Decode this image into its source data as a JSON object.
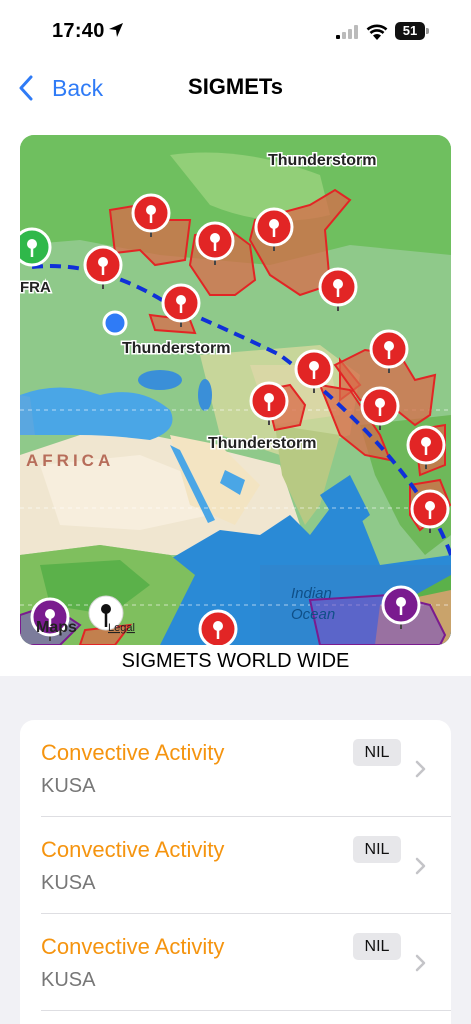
{
  "status_bar": {
    "time": "17:40",
    "battery": "51"
  },
  "nav": {
    "back_label": "Back",
    "title": "SIGMETs"
  },
  "map": {
    "labels": {
      "t1": "Thunderstorm",
      "t2": "Thunderstorm",
      "t3": "Thunderstorm",
      "africa": "AFRICA",
      "fra": "FRA",
      "indian": "Indian",
      "ocean": "Ocean",
      "maps": "Maps",
      "legal": "Legal"
    },
    "caption": "SIGMETS WORLD WIDE"
  },
  "list": {
    "items": [
      {
        "title": "Convective Activity",
        "station": "KUSA",
        "badge": "NIL"
      },
      {
        "title": "Convective Activity",
        "station": "KUSA",
        "badge": "NIL"
      },
      {
        "title": "Convective Activity",
        "station": "KUSA",
        "badge": "NIL"
      }
    ]
  },
  "colors": {
    "accent": "#2f7bf6",
    "title_orange": "#f5940f",
    "sigmet_red": "#e22525",
    "sigmet_purple": "#7a1b8f"
  }
}
